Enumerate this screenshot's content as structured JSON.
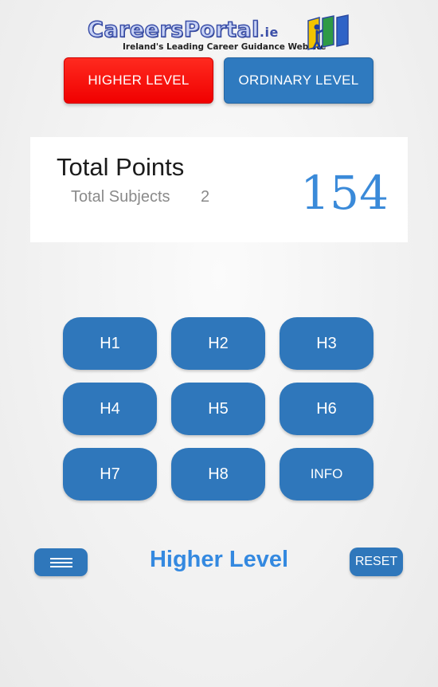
{
  "logo": {
    "brand": "CareersPortal",
    "brand_suffix": ".ie",
    "tagline": "Ireland's Leading Career Guidance Website"
  },
  "level_tabs": {
    "higher": "HIGHER LEVEL",
    "ordinary": "ORDINARY LEVEL",
    "active": "higher",
    "active_color": "#ff0000",
    "inactive_color": "#2f7abf"
  },
  "summary": {
    "title": "Total Points",
    "subjects_label": "Total Subjects",
    "subjects_count": "2",
    "points": "154"
  },
  "grades": [
    "H1",
    "H2",
    "H3",
    "H4",
    "H5",
    "H6",
    "H7",
    "H8",
    "INFO"
  ],
  "bottom_bar": {
    "menu_icon": "hamburger-menu-icon",
    "title": "Higher Level",
    "reset_label": "RESET"
  }
}
